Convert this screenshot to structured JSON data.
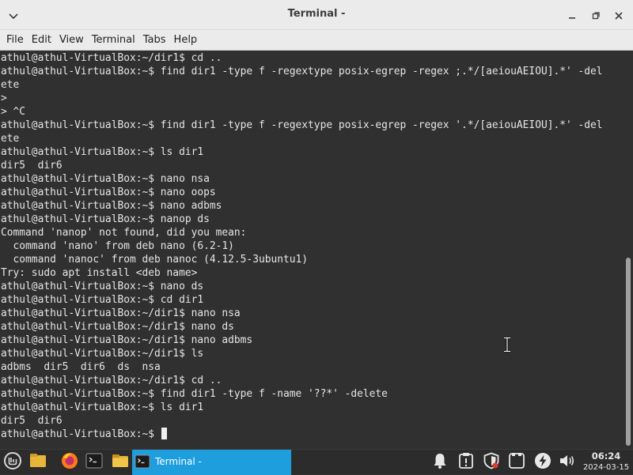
{
  "window": {
    "title": "Terminal -"
  },
  "menubar": {
    "items": [
      "File",
      "Edit",
      "View",
      "Terminal",
      "Tabs",
      "Help"
    ]
  },
  "terminal": {
    "lines": [
      "athul@athul-VirtualBox:~/dir1$ cd ..",
      "athul@athul-VirtualBox:~$ find dir1 -type f -regextype posix-egrep -regex ;.*/[aeiouAEIOU].*' -del",
      "ete",
      ">",
      "> ^C",
      "athul@athul-VirtualBox:~$ find dir1 -type f -regextype posix-egrep -regex '.*/[aeiouAEIOU].*' -del",
      "ete",
      "athul@athul-VirtualBox:~$ ls dir1",
      "dir5  dir6",
      "athul@athul-VirtualBox:~$ nano nsa",
      "athul@athul-VirtualBox:~$ nano oops",
      "athul@athul-VirtualBox:~$ nano adbms",
      "athul@athul-VirtualBox:~$ nanop ds",
      "Command 'nanop' not found, did you mean:",
      "  command 'nano' from deb nano (6.2-1)",
      "  command 'nanoc' from deb nanoc (4.12.5-3ubuntu1)",
      "Try: sudo apt install <deb name>",
      "athul@athul-VirtualBox:~$ nano ds",
      "athul@athul-VirtualBox:~$ cd dir1",
      "athul@athul-VirtualBox:~/dir1$ nano nsa",
      "athul@athul-VirtualBox:~/dir1$ nano ds",
      "athul@athul-VirtualBox:~/dir1$ nano adbms",
      "athul@athul-VirtualBox:~/dir1$ ls",
      "adbms  dir5  dir6  ds  nsa",
      "athul@athul-VirtualBox:~/dir1$ cd ..",
      "athul@athul-VirtualBox:~$ find dir1 -type f -name '??*' -delete",
      "athul@athul-VirtualBox:~$ ls dir1",
      "dir5  dir6"
    ],
    "prompt": "athul@athul-VirtualBox:~$ "
  },
  "taskbar": {
    "active_task_label": "Terminal -",
    "clock_time": "06:24",
    "clock_date": "2024-03-15"
  },
  "colors": {
    "terminal_bg": "#303030",
    "terminal_fg": "#e6e6e6",
    "taskbar_bg": "#2c2c2c",
    "active_task": "#1f9ede",
    "mint_green": "#87cf3e"
  },
  "icons": [
    "window-menu-icon",
    "minimize-icon",
    "maximize-icon",
    "close-icon",
    "mint-menu-icon",
    "show-desktop-icon",
    "firefox-icon",
    "terminal-launcher-icon",
    "file-manager-icon",
    "terminal-task-icon",
    "notifications-icon",
    "update-manager-icon",
    "firewall-icon",
    "clipboard-icon",
    "network-icon",
    "volume-icon"
  ]
}
